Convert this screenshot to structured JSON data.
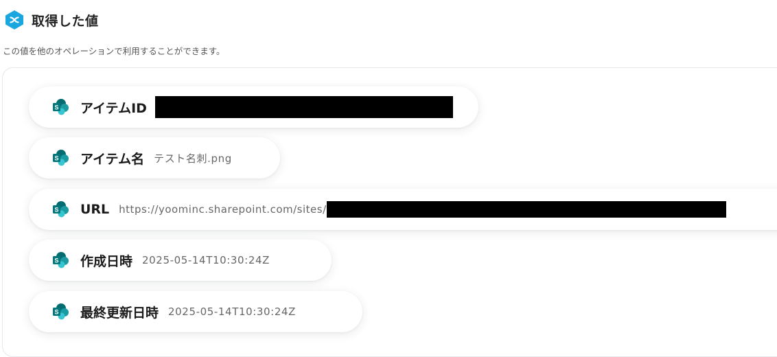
{
  "header": {
    "title": "取得した値",
    "icon": "x-hexagon-icon",
    "icon_color": "#1aa7e0"
  },
  "description": "この値を他のオペレーションで利用することができます。",
  "items": [
    {
      "label": "アイテムID",
      "value": "",
      "redacted": true
    },
    {
      "label": "アイテム名",
      "value": "テスト名刺.png",
      "redacted": false
    },
    {
      "label": "URL",
      "value": "https://yoominc.sharepoint.com/sites/",
      "redacted": true
    },
    {
      "label": "作成日時",
      "value": "2025-05-14T10:30:24Z",
      "redacted": false
    },
    {
      "label": "最終更新日時",
      "value": "2025-05-14T10:30:24Z",
      "redacted": false
    }
  ],
  "item_icon": "sharepoint-icon",
  "colors": {
    "sharepoint_dark": "#036c70",
    "sharepoint_mid": "#1a9ba1",
    "sharepoint_light": "#37c6d0"
  }
}
